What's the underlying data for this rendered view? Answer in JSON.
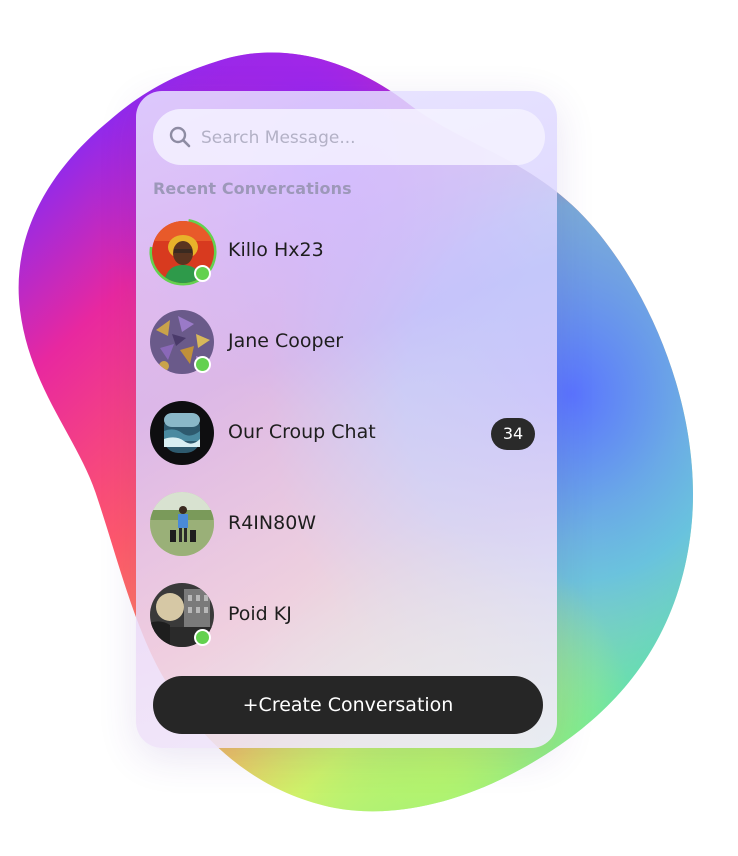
{
  "search": {
    "placeholder": "Search Message..."
  },
  "section_title": "Recent Convercations",
  "conversations": [
    {
      "name": "Killo Hx23",
      "online": true,
      "story_ring": true,
      "avatar_icon": "person-portrait-icon"
    },
    {
      "name": "Jane Cooper",
      "online": true,
      "story_ring": false,
      "avatar_icon": "leaves-photo-icon"
    },
    {
      "name": "Our Croup Chat",
      "online": false,
      "story_ring": false,
      "unread_count": "34",
      "avatar_icon": "ocean-window-icon"
    },
    {
      "name": "R4IN80W",
      "online": false,
      "story_ring": false,
      "avatar_icon": "golfer-field-icon"
    },
    {
      "name": "Poid KJ",
      "online": true,
      "story_ring": false,
      "avatar_icon": "sunset-building-icon"
    }
  ],
  "create_button_label": "+Create Conversation",
  "colors": {
    "online": "#63d14f",
    "button_bg": "#262626",
    "badge_bg": "#2a2a2a",
    "section_title": "#9d98b9"
  }
}
